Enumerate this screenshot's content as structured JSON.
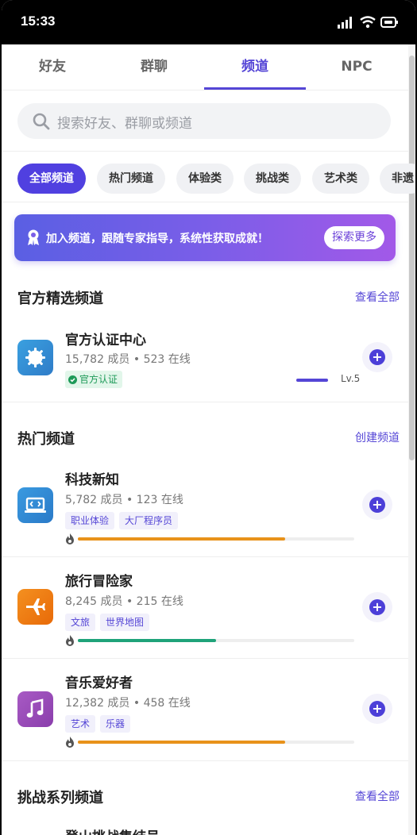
{
  "status": {
    "time": "15:33"
  },
  "tabs": [
    {
      "label": "好友"
    },
    {
      "label": "群聊"
    },
    {
      "label": "频道",
      "active": true
    },
    {
      "label": "NPC"
    }
  ],
  "search": {
    "placeholder": "搜索好友、群聊或频道"
  },
  "chips": [
    {
      "label": "全部频道",
      "active": true
    },
    {
      "label": "热门频道"
    },
    {
      "label": "体验类"
    },
    {
      "label": "挑战类"
    },
    {
      "label": "艺术类"
    },
    {
      "label": "非遗"
    }
  ],
  "banner": {
    "text": "加入频道，跟随专家指导，系统性获取成就！",
    "button": "探索更多"
  },
  "official": {
    "title": "官方精选频道",
    "link": "查看全部",
    "channel": {
      "name": "官方认证中心",
      "stats": "15,782 成员 • 523 在线",
      "badge": "官方认证",
      "level": "Lv.5",
      "level_progress": 0.9,
      "icon": "gear-badge-icon"
    }
  },
  "hot": {
    "title": "热门频道",
    "link": "创建频道",
    "channels": [
      {
        "name": "科技新知",
        "stats": "5,782 成员 • 123 在线",
        "tags": [
          "职业体验",
          "大厂程序员"
        ],
        "heat": 0.75,
        "heat_color": "#e8921a",
        "icon": "laptop-code-icon",
        "icon_color": "#3a8fd6"
      },
      {
        "name": "旅行冒险家",
        "stats": "8,245 成员 • 215 在线",
        "tags": [
          "文旅",
          "世界地图"
        ],
        "heat": 0.5,
        "heat_color": "#1fa37a",
        "icon": "airplane-icon",
        "icon_color": "#ee7d14"
      },
      {
        "name": "音乐爱好者",
        "stats": "12,382 成员 • 458 在线",
        "tags": [
          "艺术",
          "乐器"
        ],
        "heat": 0.75,
        "heat_color": "#e8921a",
        "icon": "music-note-icon",
        "icon_color": "#9a49b8"
      }
    ]
  },
  "challenge": {
    "title": "挑战系列频道",
    "link": "查看全部",
    "first_channel": "登山挑战集结号"
  }
}
